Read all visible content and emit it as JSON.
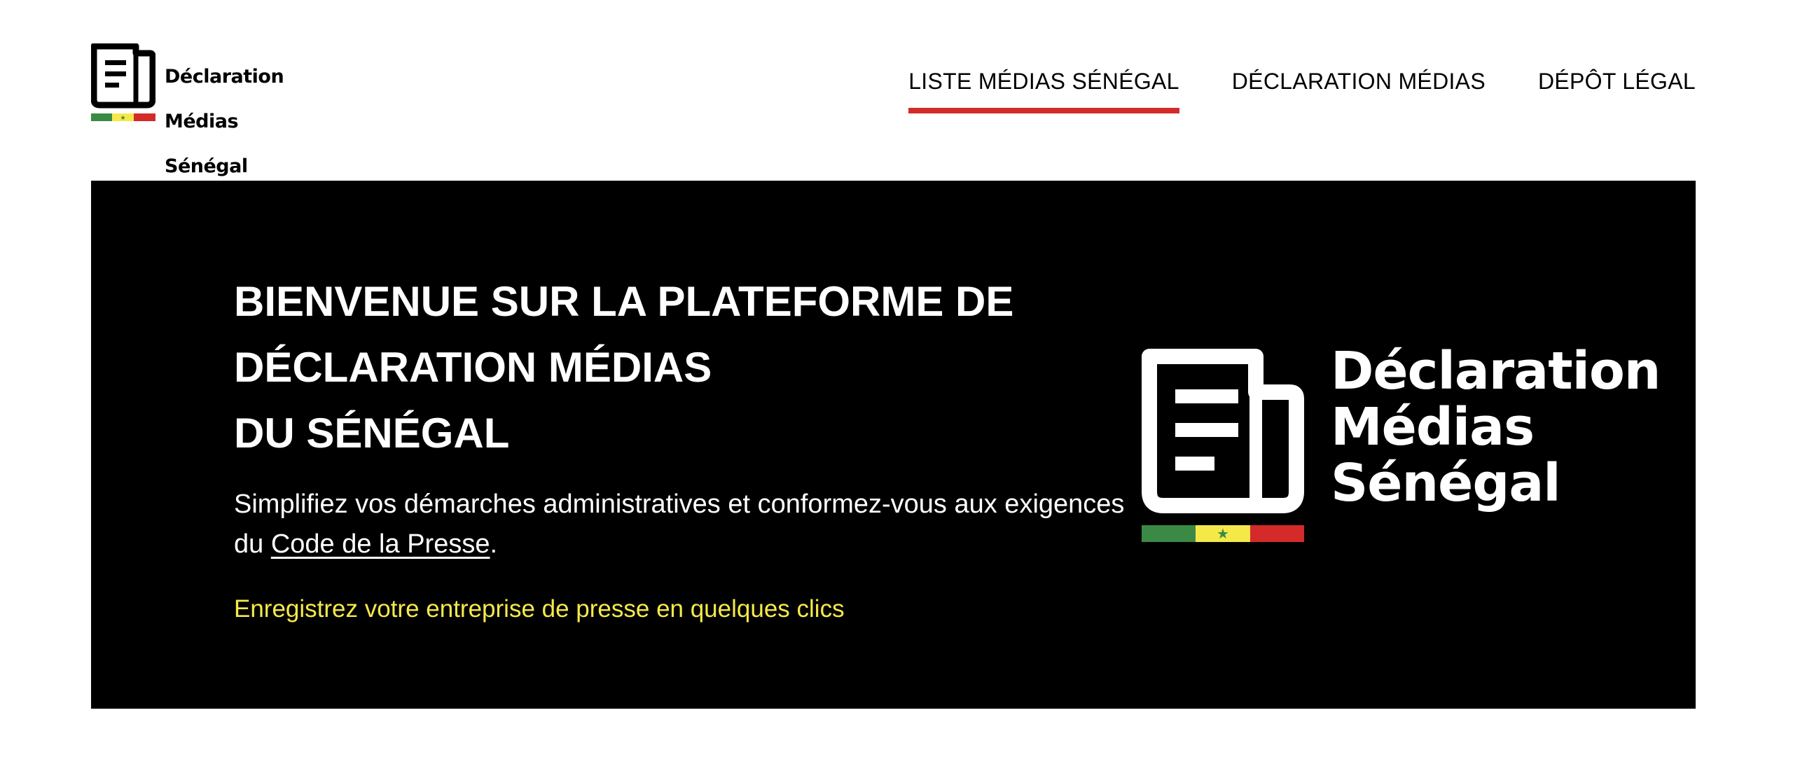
{
  "brand": {
    "name_lines": [
      "Déclaration",
      "Médias",
      "Sénégal"
    ],
    "flag_colors": {
      "green": "#3a8a45",
      "yellow": "#f5e94a",
      "red": "#d42a2a"
    },
    "icon": "newspaper-icon"
  },
  "nav": {
    "items": [
      {
        "label": "LISTE MÉDIAS SÉNÉGAL",
        "active": true
      },
      {
        "label": "DÉCLARATION MÉDIAS",
        "active": false
      },
      {
        "label": "DÉPÔT LÉGAL",
        "active": false
      }
    ],
    "active_color": "#d42a2a"
  },
  "hero": {
    "title_lines": [
      "BIENVENUE SUR LA PLATEFORME DE",
      "DÉCLARATION MÉDIAS",
      "DU SÉNÉGAL"
    ],
    "subtitle_before": "Simplifiez vos démarches administratives et conformez-vous aux exigences du ",
    "subtitle_link": "Code de la Presse",
    "subtitle_after": ".",
    "cta": "Enregistrez votre entreprise de presse en quelques clics",
    "cta_color": "#f5e94a",
    "background": "#000000"
  }
}
